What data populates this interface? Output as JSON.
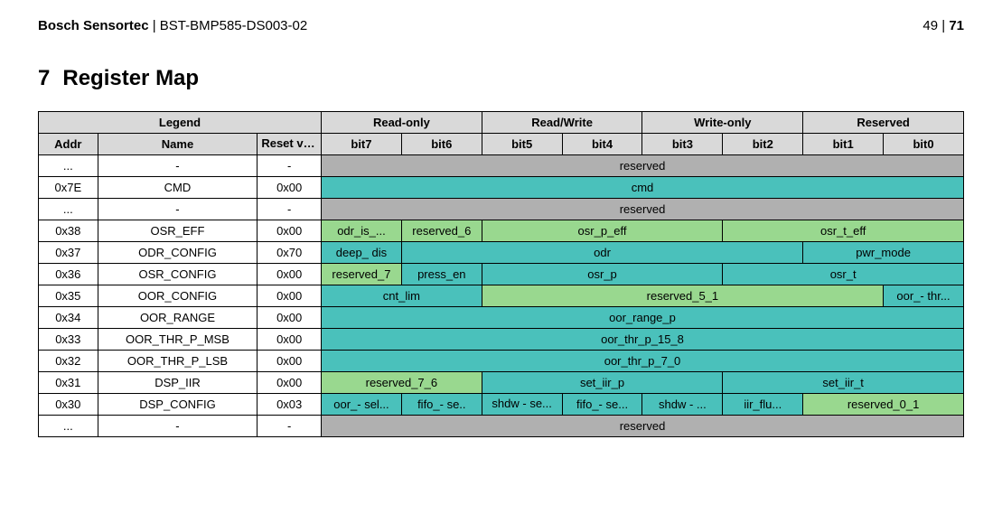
{
  "header": {
    "brand": "Bosch Sensortec",
    "sep": " | ",
    "doc": "BST-BMP585-DS003-02",
    "page_current": "49",
    "page_sep": " | ",
    "page_total": "71"
  },
  "section": {
    "num": "7",
    "title": "Register Map"
  },
  "legend": {
    "legend": "Legend",
    "readonly": "Read-only",
    "readwrite": "Read/Write",
    "writeonly": "Write-only",
    "reserved": "Reserved"
  },
  "cols": {
    "addr": "Addr",
    "name": "Name",
    "reset": "Reset value",
    "b7": "bit7",
    "b6": "bit6",
    "b5": "bit5",
    "b4": "bit4",
    "b3": "bit3",
    "b2": "bit2",
    "b1": "bit1",
    "b0": "bit0"
  },
  "rows": {
    "r0": {
      "addr": "...",
      "name": "-",
      "reset": "-",
      "f0": "reserved"
    },
    "r1": {
      "addr": "0x7E",
      "name": "CMD",
      "reset": "0x00",
      "f0": "cmd"
    },
    "r2": {
      "addr": "...",
      "name": "-",
      "reset": "-",
      "f0": "reserved"
    },
    "r3": {
      "addr": "0x38",
      "name": "OSR_EFF",
      "reset": "0x00",
      "f0": "odr_is_...",
      "f1": "reserved_6",
      "f2": "osr_p_eff",
      "f3": "osr_t_eff"
    },
    "r4": {
      "addr": "0x37",
      "name": "ODR_CONFIG",
      "reset": "0x70",
      "f0": "deep_ dis",
      "f1": "odr",
      "f2": "pwr_mode"
    },
    "r5": {
      "addr": "0x36",
      "name": "OSR_CONFIG",
      "reset": "0x00",
      "f0": "reserved_7",
      "f1": "press_en",
      "f2": "osr_p",
      "f3": "osr_t"
    },
    "r6": {
      "addr": "0x35",
      "name": "OOR_CONFIG",
      "reset": "0x00",
      "f0": "cnt_lim",
      "f1": "reserved_5_1",
      "f2": "oor_- thr..."
    },
    "r7": {
      "addr": "0x34",
      "name": "OOR_RANGE",
      "reset": "0x00",
      "f0": "oor_range_p"
    },
    "r8": {
      "addr": "0x33",
      "name": "OOR_THR_P_MSB",
      "reset": "0x00",
      "f0": "oor_thr_p_15_8"
    },
    "r9": {
      "addr": "0x32",
      "name": "OOR_THR_P_LSB",
      "reset": "0x00",
      "f0": "oor_thr_p_7_0"
    },
    "r10": {
      "addr": "0x31",
      "name": "DSP_IIR",
      "reset": "0x00",
      "f0": "reserved_7_6",
      "f1": "set_iir_p",
      "f2": "set_iir_t"
    },
    "r11": {
      "addr": "0x30",
      "name": "DSP_CONFIG",
      "reset": "0x03",
      "f0": "oor_- sel...",
      "f1": "fifo_- se..",
      "f2": "shdw - se...",
      "f3": "fifo_- se...",
      "f4": "shdw - ...",
      "f5": "iir_flu...",
      "f6": "reserved_0_1"
    },
    "r12": {
      "addr": "...",
      "name": "-",
      "reset": "-",
      "f0": "reserved"
    }
  }
}
